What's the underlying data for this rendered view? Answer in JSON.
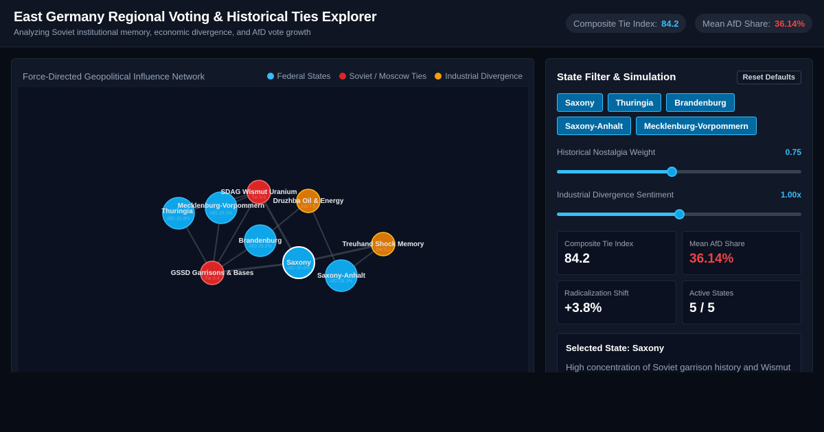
{
  "header": {
    "title": "East Germany Regional Voting & Historical Ties Explorer",
    "subtitle": "Analyzing Soviet institutional memory, economic divergence, and AfD vote growth",
    "composite_label": "Composite Tie Index:",
    "composite_value": "84.2",
    "afd_label": "Mean AfD Share:",
    "afd_value": "36.14%"
  },
  "network": {
    "title": "Force-Directed Geopolitical Influence Network",
    "legend": [
      {
        "label": "Federal States",
        "color": "#38bdf8"
      },
      {
        "label": "Soviet / Moscow Ties",
        "color": "#dc2626"
      },
      {
        "label": "Industrial Divergence",
        "color": "#f59e0b"
      }
    ],
    "nodes": [
      {
        "id": "thuringia",
        "label": "Thuringia",
        "sub": "AfD 32.8%",
        "kind": "state",
        "selected": false
      },
      {
        "id": "mv",
        "label": "Mecklenburg-Vorpommern",
        "sub": "AfD 29.0%",
        "kind": "state",
        "selected": false
      },
      {
        "id": "wismut",
        "label": "SDAG Wismut Uranium",
        "sub": "Tie 8.0",
        "kind": "soviet",
        "selected": false
      },
      {
        "id": "druzhba",
        "label": "Druzhba Oil & Energy",
        "sub": "Ind 7.5",
        "kind": "industrial",
        "selected": false
      },
      {
        "id": "brandenburg",
        "label": "Brandenburg",
        "sub": "AfD 29.2%",
        "kind": "state",
        "selected": false
      },
      {
        "id": "treuhand",
        "label": "Treuhand Shock Memory",
        "sub": "Ind 9.1",
        "kind": "industrial",
        "selected": false
      },
      {
        "id": "saxony",
        "label": "Saxony",
        "sub": "AfD 30.6%",
        "kind": "state",
        "selected": true
      },
      {
        "id": "gssd",
        "label": "GSSD Garrisons & Bases",
        "sub": "Tie 9.4",
        "kind": "soviet",
        "selected": false
      },
      {
        "id": "saxony_anhalt",
        "label": "Saxony-Anhalt",
        "sub": "AfD 28.3%",
        "kind": "state",
        "selected": false
      }
    ],
    "links": [
      [
        "thuringia",
        "gssd"
      ],
      [
        "thuringia",
        "wismut"
      ],
      [
        "mv",
        "gssd"
      ],
      [
        "mv",
        "wismut"
      ],
      [
        "wismut",
        "saxony"
      ],
      [
        "wismut",
        "gssd"
      ],
      [
        "druzhba",
        "brandenburg"
      ],
      [
        "druzhba",
        "saxony_anhalt"
      ],
      [
        "brandenburg",
        "gssd"
      ],
      [
        "saxony",
        "gssd"
      ],
      [
        "saxony",
        "treuhand"
      ],
      [
        "saxony_anhalt",
        "treuhand"
      ]
    ]
  },
  "panel": {
    "title": "State Filter & Simulation",
    "reset_label": "Reset Defaults",
    "states": [
      "Saxony",
      "Thuringia",
      "Brandenburg",
      "Saxony-Anhalt",
      "Mecklenburg-Vorpommern"
    ],
    "nostalgia_label": "Historical Nostalgia Weight",
    "nostalgia_value": "0.75",
    "nostalgia_level": 0.47,
    "divergence_label": "Industrial Divergence Sentiment",
    "divergence_value": "1.00x",
    "divergence_level": 0.5,
    "stats": [
      {
        "label": "Composite Tie Index",
        "value": "84.2",
        "color": "#ffffff"
      },
      {
        "label": "Mean AfD Share",
        "value": "36.14%",
        "color": "#ef4444"
      },
      {
        "label": "Radicalization Shift",
        "value": "+3.8%",
        "color": "#ffffff"
      },
      {
        "label": "Active States",
        "value": "5 / 5",
        "color": "#ffffff"
      }
    ],
    "selected_title": "Selected State: Saxony",
    "selected_desc": "High concentration of Soviet garrison history and Wismut"
  },
  "colors": {
    "state": "#0ea5e9",
    "state_stroke": "#38bdf8",
    "soviet": "#dc2626",
    "soviet_stroke": "#f87171",
    "industrial": "#d97706",
    "industrial_stroke": "#fbbf24"
  }
}
